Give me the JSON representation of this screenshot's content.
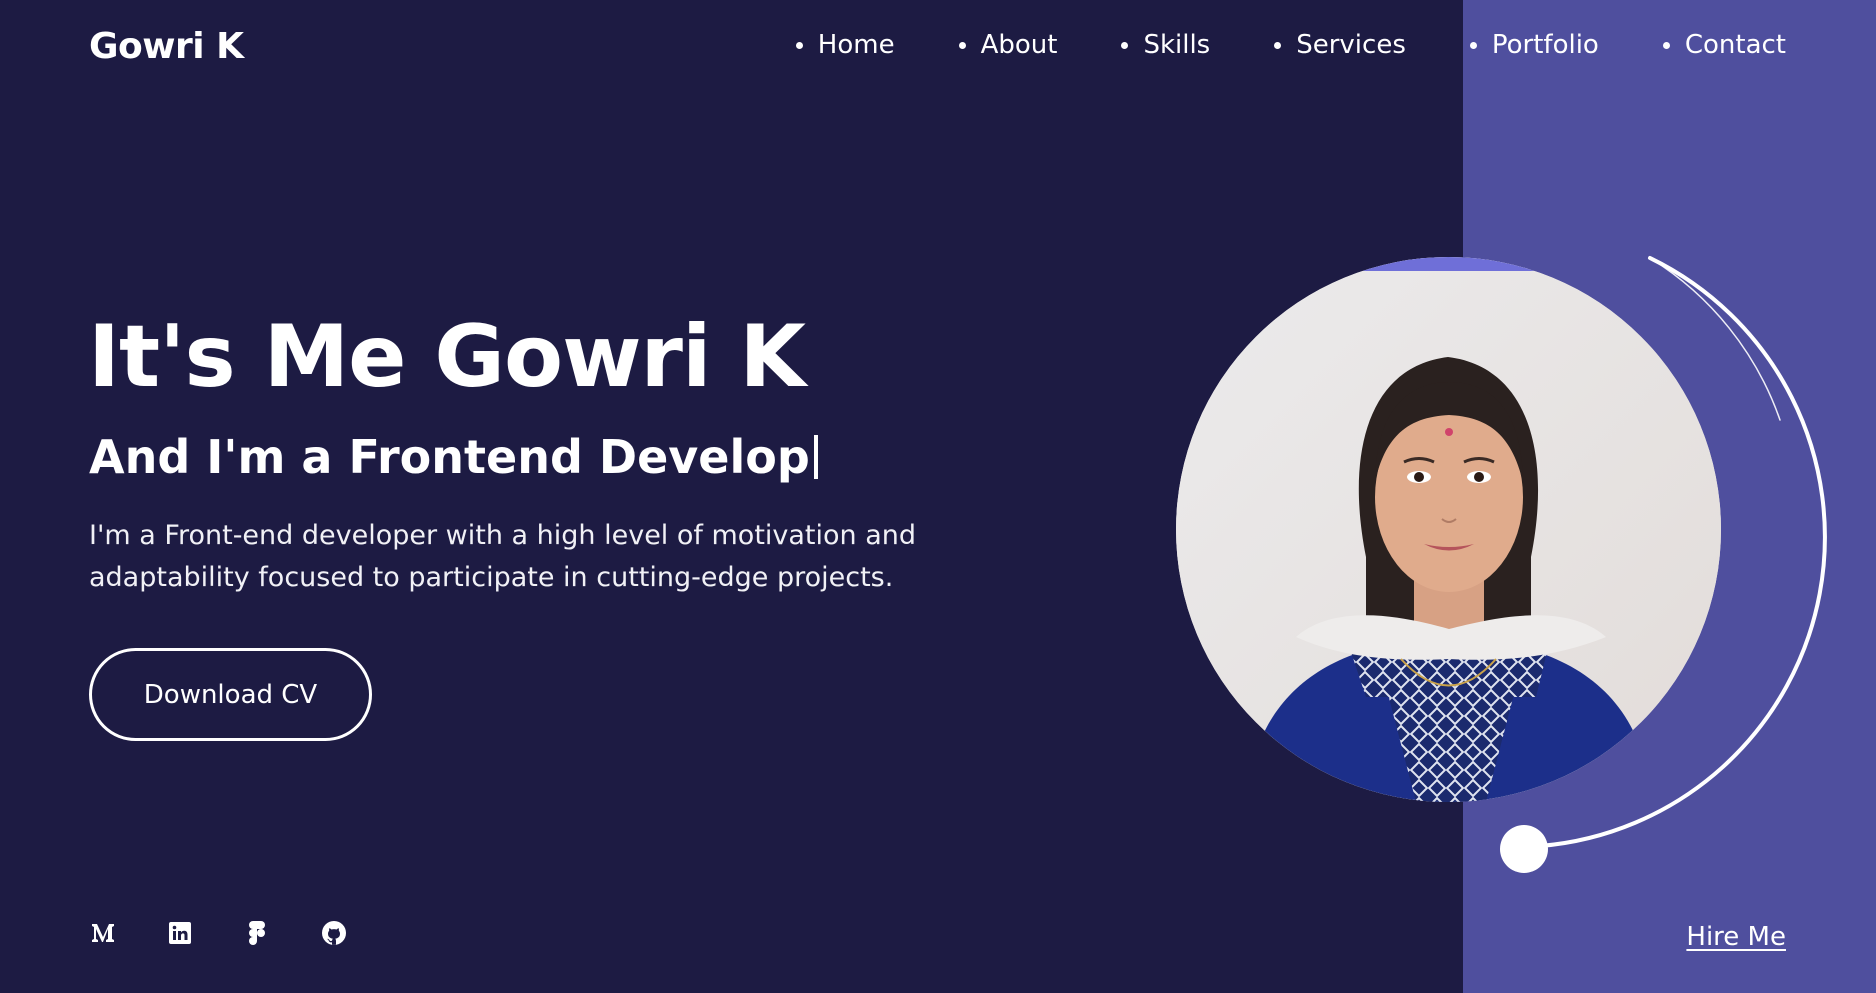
{
  "brand": {
    "name": "Gowri K"
  },
  "nav": {
    "items": [
      {
        "label": "Home"
      },
      {
        "label": "About"
      },
      {
        "label": "Skills"
      },
      {
        "label": "Services"
      },
      {
        "label": "Portfolio"
      },
      {
        "label": "Contact"
      }
    ]
  },
  "hero": {
    "title": "It's Me Gowri K",
    "subtitle": "And I'm a Frontend Develop",
    "description": "I'm a Front-end developer with a high level of motivation and adaptability focused to participate in cutting-edge projects.",
    "cv_button": "Download CV",
    "hire_link": "Hire Me"
  },
  "socials": [
    {
      "icon": "medium-icon"
    },
    {
      "icon": "linkedin-icon"
    },
    {
      "icon": "figma-icon"
    },
    {
      "icon": "github-icon"
    }
  ],
  "colors": {
    "background": "#1d1b43",
    "panel": "#4f4f9e",
    "accent": "#6b6bd6",
    "text": "#ffffff"
  }
}
